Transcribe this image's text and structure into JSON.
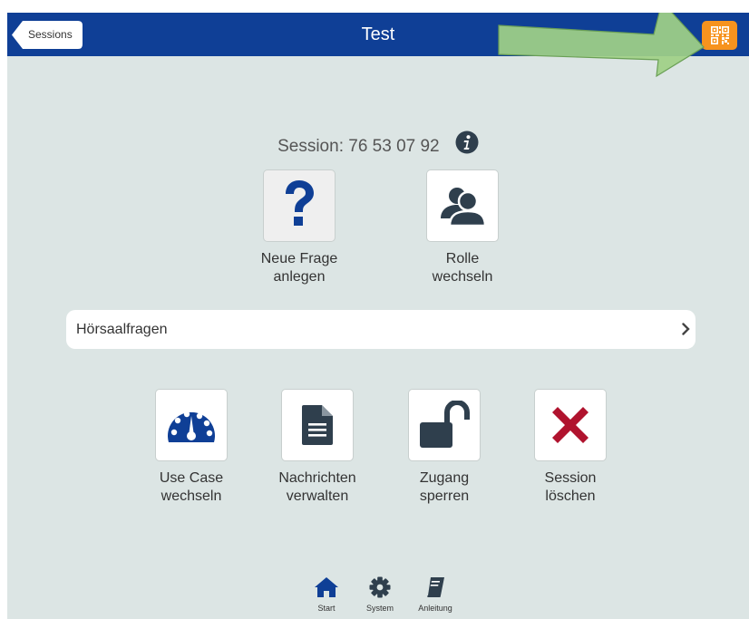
{
  "navbar": {
    "back_label": "Sessions",
    "title": "Test"
  },
  "session": {
    "text": "Session: 76 53 07 92"
  },
  "top_tiles": [
    {
      "line1": "Neue Frage",
      "line2": "anlegen"
    },
    {
      "line1": "Rolle",
      "line2": "wechseln"
    }
  ],
  "list": {
    "label": "Hörsaalfragen"
  },
  "bottom_tiles": [
    {
      "line1": "Use Case",
      "line2": "wechseln"
    },
    {
      "line1": "Nachrichten",
      "line2": "verwalten"
    },
    {
      "line1": "Zugang",
      "line2": "sperren"
    },
    {
      "line1": "Session",
      "line2": "löschen"
    }
  ],
  "tabs": [
    {
      "label": "Start"
    },
    {
      "label": "System"
    },
    {
      "label": "Anleitung"
    }
  ],
  "colors": {
    "navbar": "#0f3f96",
    "background": "#dce5e4",
    "qr_button": "#f7931e",
    "icon_dark": "#2f3f4d",
    "icon_blue": "#0f3f96",
    "delete_red": "#b0132e",
    "overlay_arrow": "#9fd187"
  },
  "icons": [
    "qr-code-icon",
    "info-icon",
    "question-icon",
    "users-icon",
    "chevron-right-icon",
    "gauge-icon",
    "document-icon",
    "unlock-icon",
    "cross-icon",
    "home-icon",
    "gear-icon",
    "book-icon"
  ]
}
